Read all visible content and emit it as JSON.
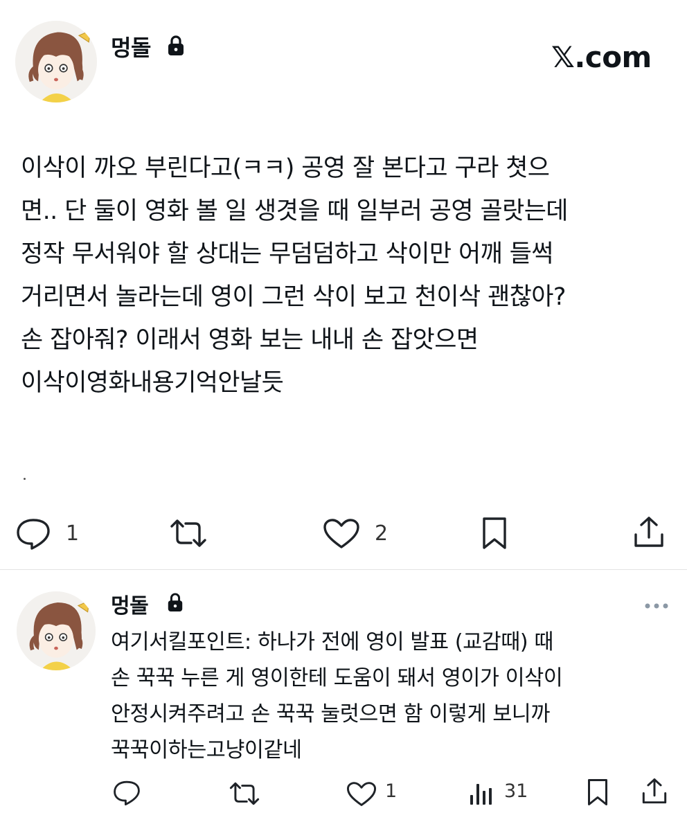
{
  "brand": "𝕏.com",
  "main_post": {
    "author": "멍돌",
    "text_lines": [
      "이삭이 까오 부린다고(ㅋㅋ) 공영 잘 본다고 구라 쳣으",
      "면.. 단 둘이 영화 볼 일 생겻을 때 일부러 공영 골랏는데",
      "정작 무서워야 할 상대는 무덤덤하고 삭이만 어깨 들썩",
      "거리면서 놀라는데 영이 그런 삭이 보고 천이삭 괜찮아?",
      "손 잡아줘? 이래서 영화 보는 내내 손 잡앗으면",
      "이삭이영화내용기억안날듯"
    ],
    "actions": {
      "reply_count": "1",
      "like_count": "2"
    }
  },
  "reply_post": {
    "author": "멍돌",
    "text_lines": [
      "여기서킬포인트: 하나가 전에 영이 발표 (교감때) 때",
      "손 꾹꾹 누른 게 영이한테 도움이 돼서 영이가 이삭이",
      "안정시켜주려고 손 꾹꾹 눌럿으면 함 이렇게 보니까",
      "꾹꾹이하는고냥이같네"
    ],
    "actions": {
      "like_count": "1",
      "views_count": "31"
    }
  },
  "icons": {
    "lock": "lock-icon",
    "reply": "reply-icon",
    "repost": "repost-icon",
    "like": "heart-icon",
    "bookmark": "bookmark-icon",
    "share": "share-icon",
    "views": "views-icon",
    "more": "more-icon"
  },
  "colors": {
    "text": "#0f1419",
    "icon": "#536471",
    "divider": "#e3e3e3"
  }
}
